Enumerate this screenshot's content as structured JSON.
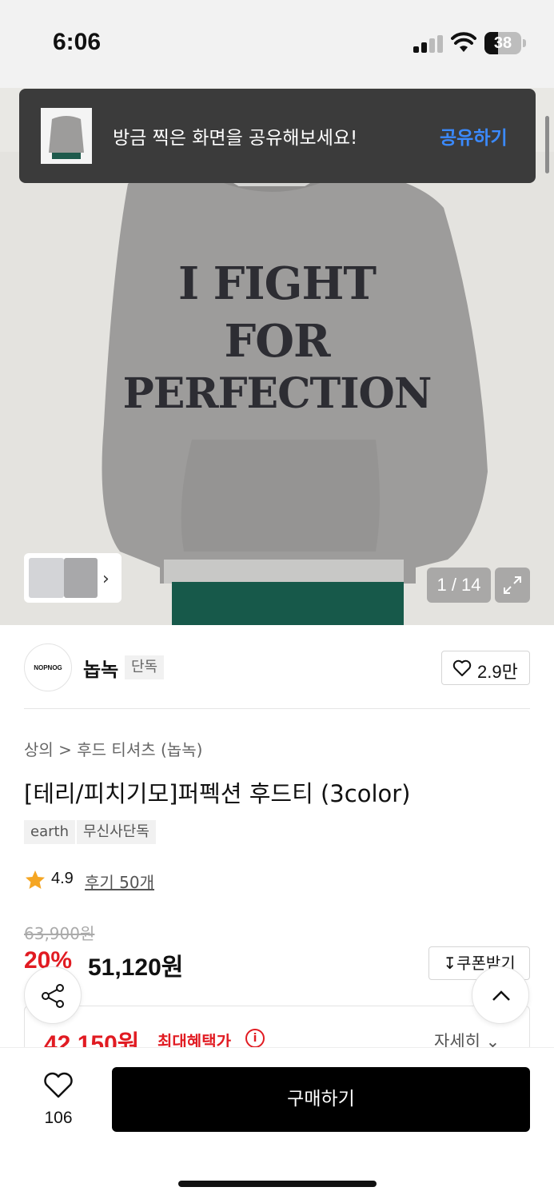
{
  "status_bar": {
    "time": "6:06",
    "battery": "38",
    "battery_level": 0.38
  },
  "toast": {
    "message": "방금 찍은 화면을 공유해보세요!",
    "action": "공유하기"
  },
  "gallery": {
    "print_lines": [
      "I FIGHT",
      "FOR",
      "PERFECTION"
    ],
    "counter": "1 / 14",
    "icons": [
      "chevron-right-icon",
      "expand-icon"
    ]
  },
  "brand": {
    "logo_text": "NOPNOG",
    "name": "놉녹",
    "tag": "단독",
    "likes": "2.9만"
  },
  "product": {
    "breadcrumb": "상의 > 후드 티셔츠 (놉녹)",
    "title": "[테리/피치기모]퍼펙션 후드티 (3color)",
    "tags": [
      "earth",
      "무신사단독"
    ],
    "rating": "4.9",
    "reviews": "후기 50개",
    "original_price": "63,900원",
    "discount": "20%",
    "sale_price": "51,120원",
    "coupon_label": "쿠폰받기",
    "best_price": "42,150원",
    "best_price_label": "최대혜택가",
    "detail_label": "자세히"
  },
  "bottom_bar": {
    "wish_count": "106",
    "buy_label": "구매하기"
  },
  "colors": {
    "accent_red": "#e11b22",
    "link_blue": "#3b8aff",
    "toast_bg": "#3b3b3b",
    "buy_bg": "#000000"
  }
}
